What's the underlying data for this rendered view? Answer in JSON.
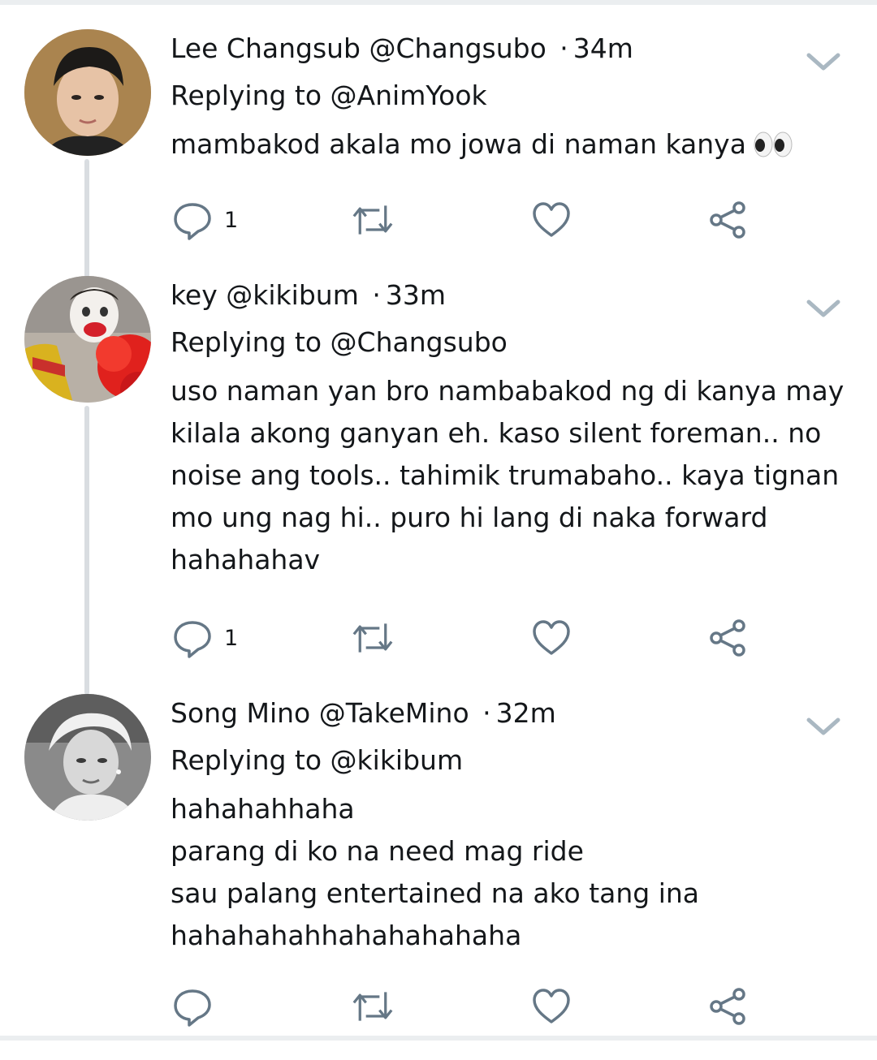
{
  "tweets": [
    {
      "display_name": "Lee Changsub",
      "handle": "@Changsubo",
      "separator": "·",
      "time": "34m",
      "replying_label": "Replying to",
      "replying_to": "@AnimYook",
      "lines": [
        "mambakod akala mo jowa di naman kanya"
      ],
      "emoji": "eyes",
      "reply_count": "1",
      "avatar": "person-dark-hair"
    },
    {
      "display_name": "key",
      "handle": "@kikibum",
      "separator": "·",
      "time": "33m",
      "replying_label": "Replying to",
      "replying_to": "@Changsubo",
      "lines": [
        "uso naman yan bro nambabakod ng di kanya may",
        "kilala akong ganyan eh. kaso silent foreman.. no",
        "noise ang tools.. tahimik trumabaho.. kaya tignan",
        "mo ung nag hi.. puro hi lang di naka forward",
        "hahahahav"
      ],
      "reply_count": "1",
      "avatar": "person-clown"
    },
    {
      "display_name": "Song Mino",
      "handle": "@TakeMino",
      "separator": "·",
      "time": "32m",
      "replying_label": "Replying to",
      "replying_to": "@kikibum",
      "lines": [
        "hahahahhaha",
        "parang di ko na need mag ride",
        "sau palang entertained na ako tang ina",
        "hahahahahhahahahahaha"
      ],
      "reply_count": "",
      "avatar": "person-grayscale"
    }
  ],
  "icons": {
    "reply": "reply-icon",
    "retweet": "retweet-icon",
    "like": "like-icon",
    "share": "share-icon",
    "menu": "chevron-down-icon"
  },
  "colors": {
    "text": "#14171a",
    "icon": "#657786",
    "thread_line": "#d9dde1",
    "chevron": "#aab8c2"
  }
}
